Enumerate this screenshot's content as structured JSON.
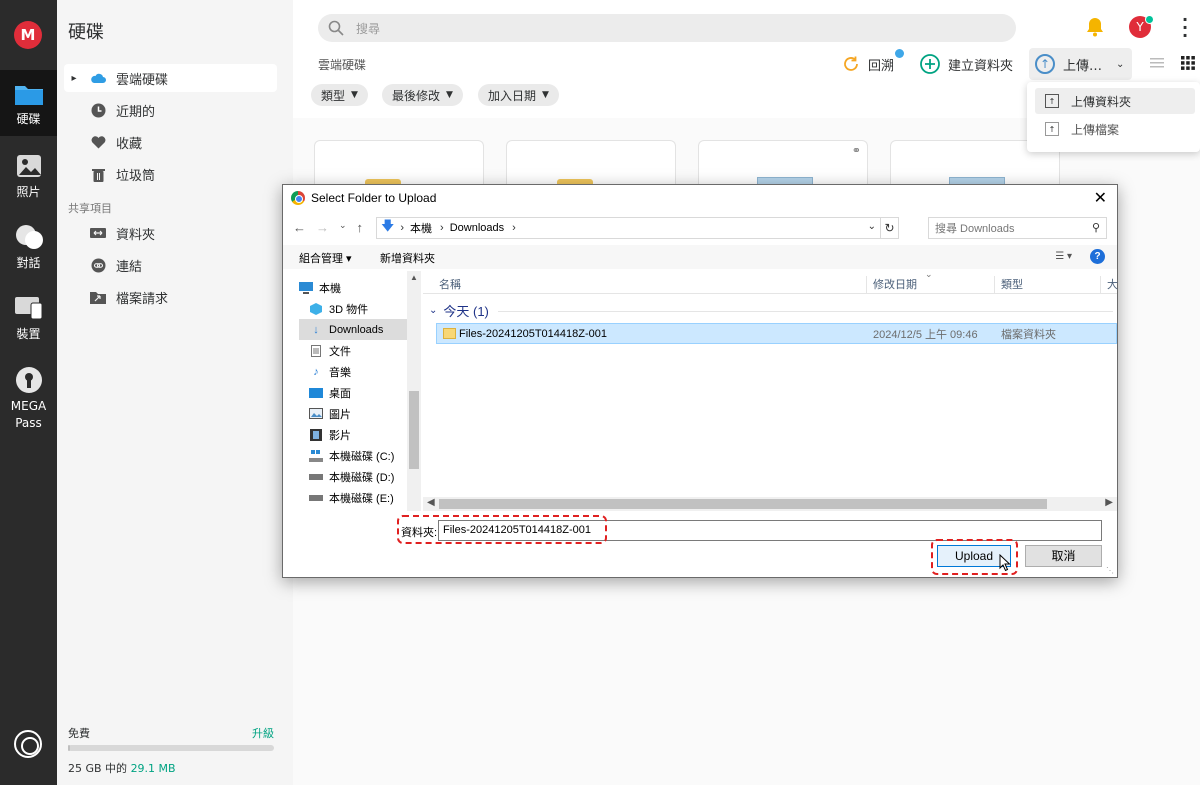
{
  "rail": {
    "logo": "M",
    "items": [
      {
        "label": "硬碟",
        "icon": "folder-icon"
      },
      {
        "label": "照片",
        "icon": "photo-icon"
      },
      {
        "label": "對話",
        "icon": "chat-icon"
      },
      {
        "label": "裝置",
        "icon": "devices-icon"
      },
      {
        "label": "MEGA\nPass",
        "label1": "MEGA",
        "label2": "Pass",
        "icon": "keyhole-icon"
      }
    ]
  },
  "sidebar": {
    "title": "硬碟",
    "items": [
      {
        "label": "雲端硬碟",
        "icon": "cloud-icon"
      },
      {
        "label": "近期的",
        "icon": "clock-icon"
      },
      {
        "label": "收藏",
        "icon": "heart-icon"
      },
      {
        "label": "垃圾筒",
        "icon": "trash-icon"
      }
    ],
    "shared_section": "共享項目",
    "shared_items": [
      {
        "label": "資料夾",
        "icon": "shared-folder-icon"
      },
      {
        "label": "連結",
        "icon": "link-icon"
      },
      {
        "label": "檔案請求",
        "icon": "file-request-icon"
      }
    ],
    "storage": {
      "plan": "免費",
      "upgrade": "升級",
      "used_prefix": "25 GB 中的",
      "used_amount": "29.1 MB",
      "fill_fraction": 0.0012
    }
  },
  "topbar": {
    "search_placeholder": "搜尋",
    "avatar_letter": "Y"
  },
  "breadcrumb": "雲端硬碟",
  "toolbar": {
    "restore": "回溯",
    "new_folder": "建立資料夾",
    "upload": "上傳…"
  },
  "filters": [
    "類型",
    "最後修改",
    "加入日期"
  ],
  "upload_menu": {
    "folder": "上傳資料夾",
    "file": "上傳檔案"
  },
  "dialog": {
    "title": "Select Folder to Upload",
    "path": [
      "本機",
      "Downloads"
    ],
    "search_placeholder": "搜尋 Downloads",
    "organize": "組合管理 ▾",
    "new_folder": "新增資料夾",
    "nav_items": [
      {
        "label": "本機",
        "icon": "pc-icon"
      },
      {
        "label": "3D 物件",
        "icon": "cube-icon"
      },
      {
        "label": "Downloads",
        "icon": "download-icon"
      },
      {
        "label": "文件",
        "icon": "document-icon"
      },
      {
        "label": "音樂",
        "icon": "music-icon"
      },
      {
        "label": "桌面",
        "icon": "desktop-icon"
      },
      {
        "label": "圖片",
        "icon": "picture-icon"
      },
      {
        "label": "影片",
        "icon": "video-icon"
      },
      {
        "label": "本機磁碟 (C:)",
        "icon": "drive-icon"
      },
      {
        "label": "本機磁碟 (D:)",
        "icon": "drive-icon"
      },
      {
        "label": "本機磁碟 (E:)",
        "icon": "drive-icon"
      }
    ],
    "columns": [
      "名稱",
      "修改日期",
      "類型",
      "大"
    ],
    "group": "今天 (1)",
    "files": [
      {
        "name": "Files-20241205T014418Z-001",
        "modified": "2024/12/5 上午 09:46",
        "type": "檔案資料夾"
      }
    ],
    "folder_label": "資料夾:",
    "folder_value": "Files-20241205T014418Z-001",
    "upload_button": "Upload",
    "cancel_button": "取消"
  },
  "colors": {
    "brand_red": "#e02d3a",
    "accent_green": "#00a382",
    "highlight_dash": "#e02020"
  }
}
